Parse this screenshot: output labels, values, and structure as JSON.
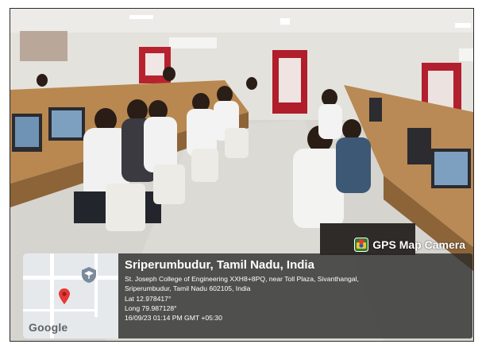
{
  "camera_badge": {
    "label": "GPS Map Camera",
    "icon": "camera-pin-icon"
  },
  "map": {
    "brand": "Google",
    "pin_color": "#e53935"
  },
  "location": {
    "title": "Sriperumbudur, Tamil Nadu, India",
    "address_line1": "St. Joseph College of Engineering XXH8+8PQ, near Toll Plaza, Sivanthangal,",
    "address_line2": "Sriperumbudur, Tamil Nadu 602105, India",
    "latitude": "Lat 12.978417°",
    "longitude": "Long 79.987128°",
    "timestamp": "16/09/23 01:14 PM GMT +05:30"
  }
}
